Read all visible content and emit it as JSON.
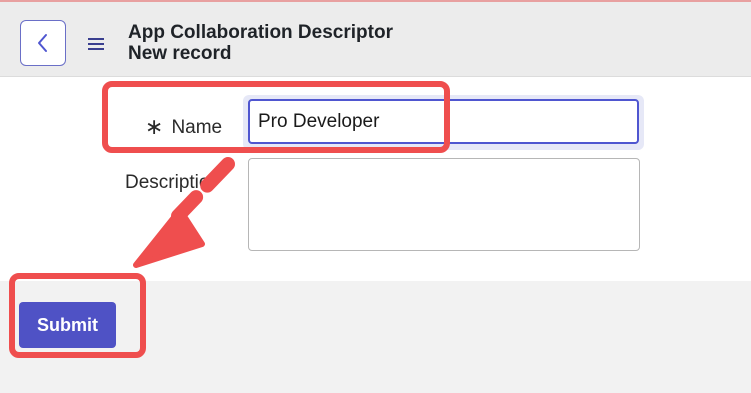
{
  "header": {
    "title": "App Collaboration Descriptor",
    "subtitle": "New record",
    "back_icon": "chevron-left-icon",
    "menu_icon": "hamburger-menu-icon"
  },
  "form": {
    "name": {
      "required_mark": "∗",
      "label": "Name",
      "value": "Pro Developer"
    },
    "description": {
      "label": "Descriptio",
      "value": ""
    }
  },
  "actions": {
    "submit_label": "Submit"
  },
  "annotations": {
    "color": "#ef4e4e",
    "arrow_icon": "diagonal-arrow-icon"
  },
  "colors": {
    "accent": "#4f52c5",
    "header_bg": "#ececec",
    "footer_bg": "#f2f2f2"
  }
}
